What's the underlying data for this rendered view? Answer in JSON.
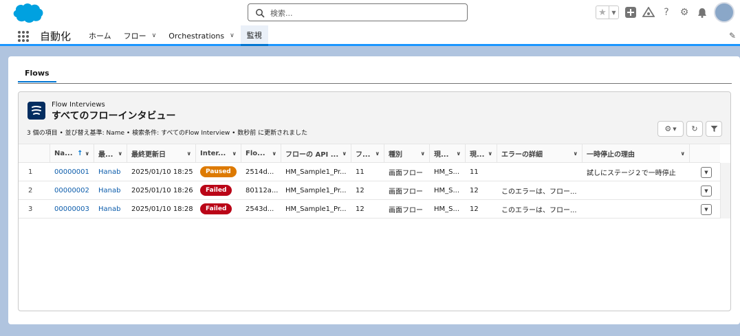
{
  "header": {
    "search_placeholder": "検索..."
  },
  "nav": {
    "app_name": "自動化",
    "tabs": [
      {
        "label": "ホーム",
        "chevron": false
      },
      {
        "label": "フロー",
        "chevron": true
      },
      {
        "label": "Orchestrations",
        "chevron": true
      },
      {
        "label": "監視",
        "chevron": false,
        "active": true
      }
    ]
  },
  "subtabs": {
    "flows": "Flows"
  },
  "list": {
    "object_label": "Flow Interviews",
    "title": "すべてのフローインタビュー",
    "meta": "3 個の項目 • 並び替え基準: Name • 検索条件: すべてのFlow Interview • 数秒前 に更新されました",
    "columns": [
      "Na...",
      "最...",
      "最終更新日",
      "Inter...",
      "Flo...",
      "フローの API ...",
      "フ...",
      "種別",
      "現...",
      "現...",
      "エラーの詳細",
      "一時停止の理由"
    ],
    "sort_indicator": "↑",
    "rows": [
      {
        "num": "1",
        "name": "00000001",
        "owner": "Hanab",
        "modified": "2025/01/10 18:25",
        "status": "Paused",
        "status_kind": "paused",
        "flow": "2514d...",
        "api": "HM_Sample1_Pr...",
        "version": "11",
        "type": "画面フロー",
        "current": "HM_S...",
        "current2": "11",
        "error": "",
        "pause": "試しにステージ２で一時停止"
      },
      {
        "num": "2",
        "name": "00000002",
        "owner": "Hanab",
        "modified": "2025/01/10 18:26",
        "status": "Failed",
        "status_kind": "failed",
        "flow": "80112a...",
        "api": "HM_Sample1_Pr...",
        "version": "12",
        "type": "画面フロー",
        "current": "HM_S...",
        "current2": "12",
        "error": "このエラーは、フロー...",
        "pause": ""
      },
      {
        "num": "3",
        "name": "00000003",
        "owner": "Hanab",
        "modified": "2025/01/10 18:28",
        "status": "Failed",
        "status_kind": "failed",
        "flow": "2543d...",
        "api": "HM_Sample1_Pr...",
        "version": "12",
        "type": "画面フロー",
        "current": "HM_S...",
        "current2": "12",
        "error": "このエラーは、フロー...",
        "pause": ""
      }
    ]
  },
  "colors": {
    "brand": "#00a1e0",
    "accent": "#0176d3",
    "link": "#0b5cab",
    "paused": "#dd7a01",
    "failed": "#ba0517",
    "object_icon": "#032d60"
  }
}
